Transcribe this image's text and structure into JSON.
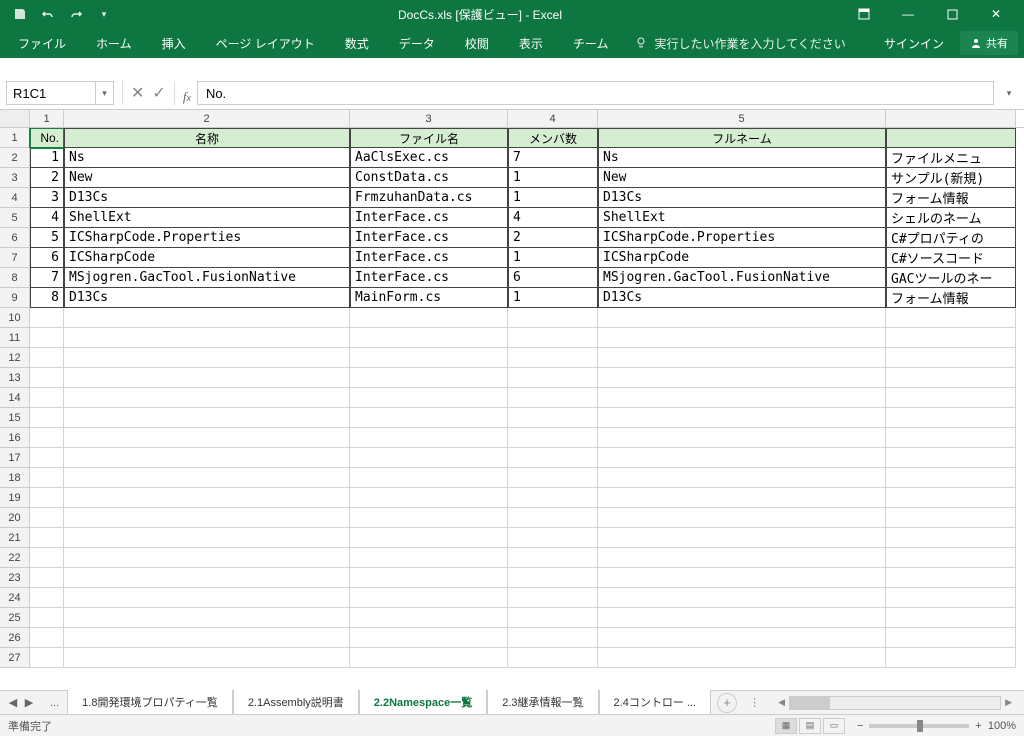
{
  "titlebar": {
    "title": "DocCs.xls  [保護ビュー] - Excel"
  },
  "ribbon": {
    "file": "ファイル",
    "tabs": [
      "ホーム",
      "挿入",
      "ページ レイアウト",
      "数式",
      "データ",
      "校閲",
      "表示",
      "チーム"
    ],
    "tellme": "実行したい作業を入力してください",
    "signin": "サインイン",
    "share": "共有"
  },
  "formula": {
    "namebox": "R1C1",
    "value": "No."
  },
  "colHeaders": [
    "1",
    "2",
    "3",
    "4",
    "5"
  ],
  "headers": {
    "c1": "No.",
    "c2": "名称",
    "c3": "ファイル名",
    "c4": "メンバ数",
    "c5": "フルネーム",
    "c6": ""
  },
  "rows": [
    {
      "no": "1",
      "name": "Ns",
      "file": "AaClsExec.cs",
      "members": "7",
      "full": "Ns",
      "desc": "ファイルメニュ"
    },
    {
      "no": "2",
      "name": "New",
      "file": "ConstData.cs",
      "members": "1",
      "full": "New",
      "desc": "サンプル(新規)"
    },
    {
      "no": "3",
      "name": "D13Cs",
      "file": "FrmzuhanData.cs",
      "members": "1",
      "full": "D13Cs",
      "desc": "フォーム情報"
    },
    {
      "no": "4",
      "name": "ShellExt",
      "file": "InterFace.cs",
      "members": "4",
      "full": "ShellExt",
      "desc": "シェルのネーム"
    },
    {
      "no": "5",
      "name": "ICSharpCode.Properties",
      "file": "InterFace.cs",
      "members": "2",
      "full": "ICSharpCode.Properties",
      "desc": "C#プロパティの"
    },
    {
      "no": "6",
      "name": "ICSharpCode",
      "file": "InterFace.cs",
      "members": "1",
      "full": "ICSharpCode",
      "desc": "C#ソースコード"
    },
    {
      "no": "7",
      "name": "MSjogren.GacTool.FusionNative",
      "file": "InterFace.cs",
      "members": "6",
      "full": "MSjogren.GacTool.FusionNative",
      "desc": "GACツールのネー"
    },
    {
      "no": "8",
      "name": "D13Cs",
      "file": "MainForm.cs",
      "members": "1",
      "full": "D13Cs",
      "desc": "フォーム情報"
    }
  ],
  "sheets": {
    "tabs": [
      "1.8開発環境プロパティ一覧",
      "2.1Assembly説明書",
      "2.2Namespace一覧",
      "2.3継承情報一覧",
      "2.4コントロー ..."
    ],
    "activeIndex": 2
  },
  "status": {
    "ready": "準備完了",
    "zoom": "100%"
  }
}
